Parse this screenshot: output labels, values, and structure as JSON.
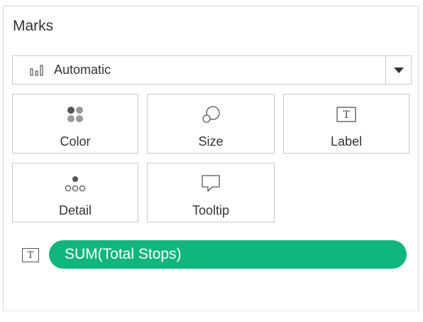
{
  "marks_card": {
    "title": "Marks",
    "mark_type": {
      "selected": "Automatic",
      "icon": "bar-chart-icon"
    },
    "shelves": [
      {
        "label": "Color",
        "icon": "color-dots-icon"
      },
      {
        "label": "Size",
        "icon": "size-circles-icon"
      },
      {
        "label": "Label",
        "icon": "text-label-icon"
      },
      {
        "label": "Detail",
        "icon": "detail-dots-icon"
      },
      {
        "label": "Tooltip",
        "icon": "speech-bubble-icon"
      }
    ],
    "fields": [
      {
        "name": "SUM(Total Stops)",
        "encoding_icon": "text-label-icon",
        "encoding_glyph": "T",
        "color": "#10b67e"
      }
    ]
  }
}
